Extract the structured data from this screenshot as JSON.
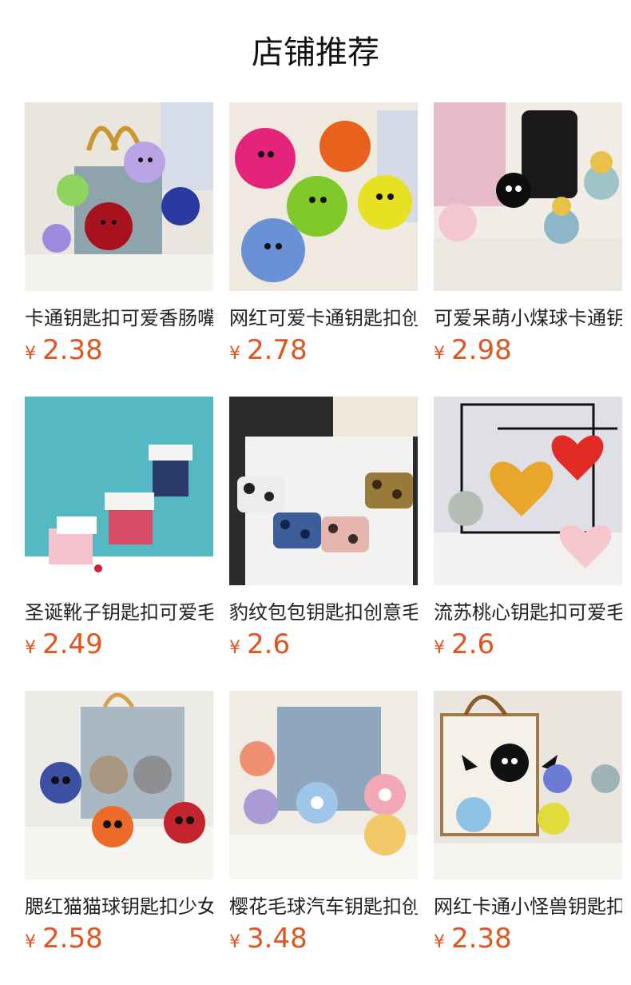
{
  "page": {
    "title": "店铺推荐"
  },
  "currency_symbol": "¥",
  "colors": {
    "price": "#e2541e",
    "title": "#111111",
    "text": "#222222",
    "background": "#ffffff"
  },
  "products": [
    {
      "name": "卡通钥匙扣可爱香肠嘴毛绒公仔",
      "price": "2.38",
      "image": "plush-monster-keychains-denim-bag"
    },
    {
      "name": "网红可爱卡通钥匙扣创意毛绒挂件",
      "price": "2.78",
      "image": "colorful-furry-monster-keychains"
    },
    {
      "name": "可爱呆萌小煤球卡通钥匙扣",
      "price": "2.98",
      "image": "soot-sprite-keychains-with-hats"
    },
    {
      "name": "圣诞靴子钥匙扣可爱毛绒挂件",
      "price": "2.49",
      "image": "christmas-boot-plush-keychains"
    },
    {
      "name": "豹纹包包钥匙扣创意毛绒挂件",
      "price": "2.6",
      "image": "leopard-print-mini-bag-keychains"
    },
    {
      "name": "流苏桃心钥匙扣可爱毛绒挂件",
      "price": "2.6",
      "image": "heart-pompom-tassel-keychains"
    },
    {
      "name": "腮红猫猫球钥匙扣少女心挂件",
      "price": "2.58",
      "image": "blush-cat-pompom-keychains"
    },
    {
      "name": "樱花毛球汽车钥匙扣创意挂件",
      "price": "3.48",
      "image": "flower-pompom-car-keychains"
    },
    {
      "name": "网红卡通小怪兽钥匙扣创意挂件",
      "price": "2.38",
      "image": "bat-wing-monster-keychains"
    }
  ]
}
